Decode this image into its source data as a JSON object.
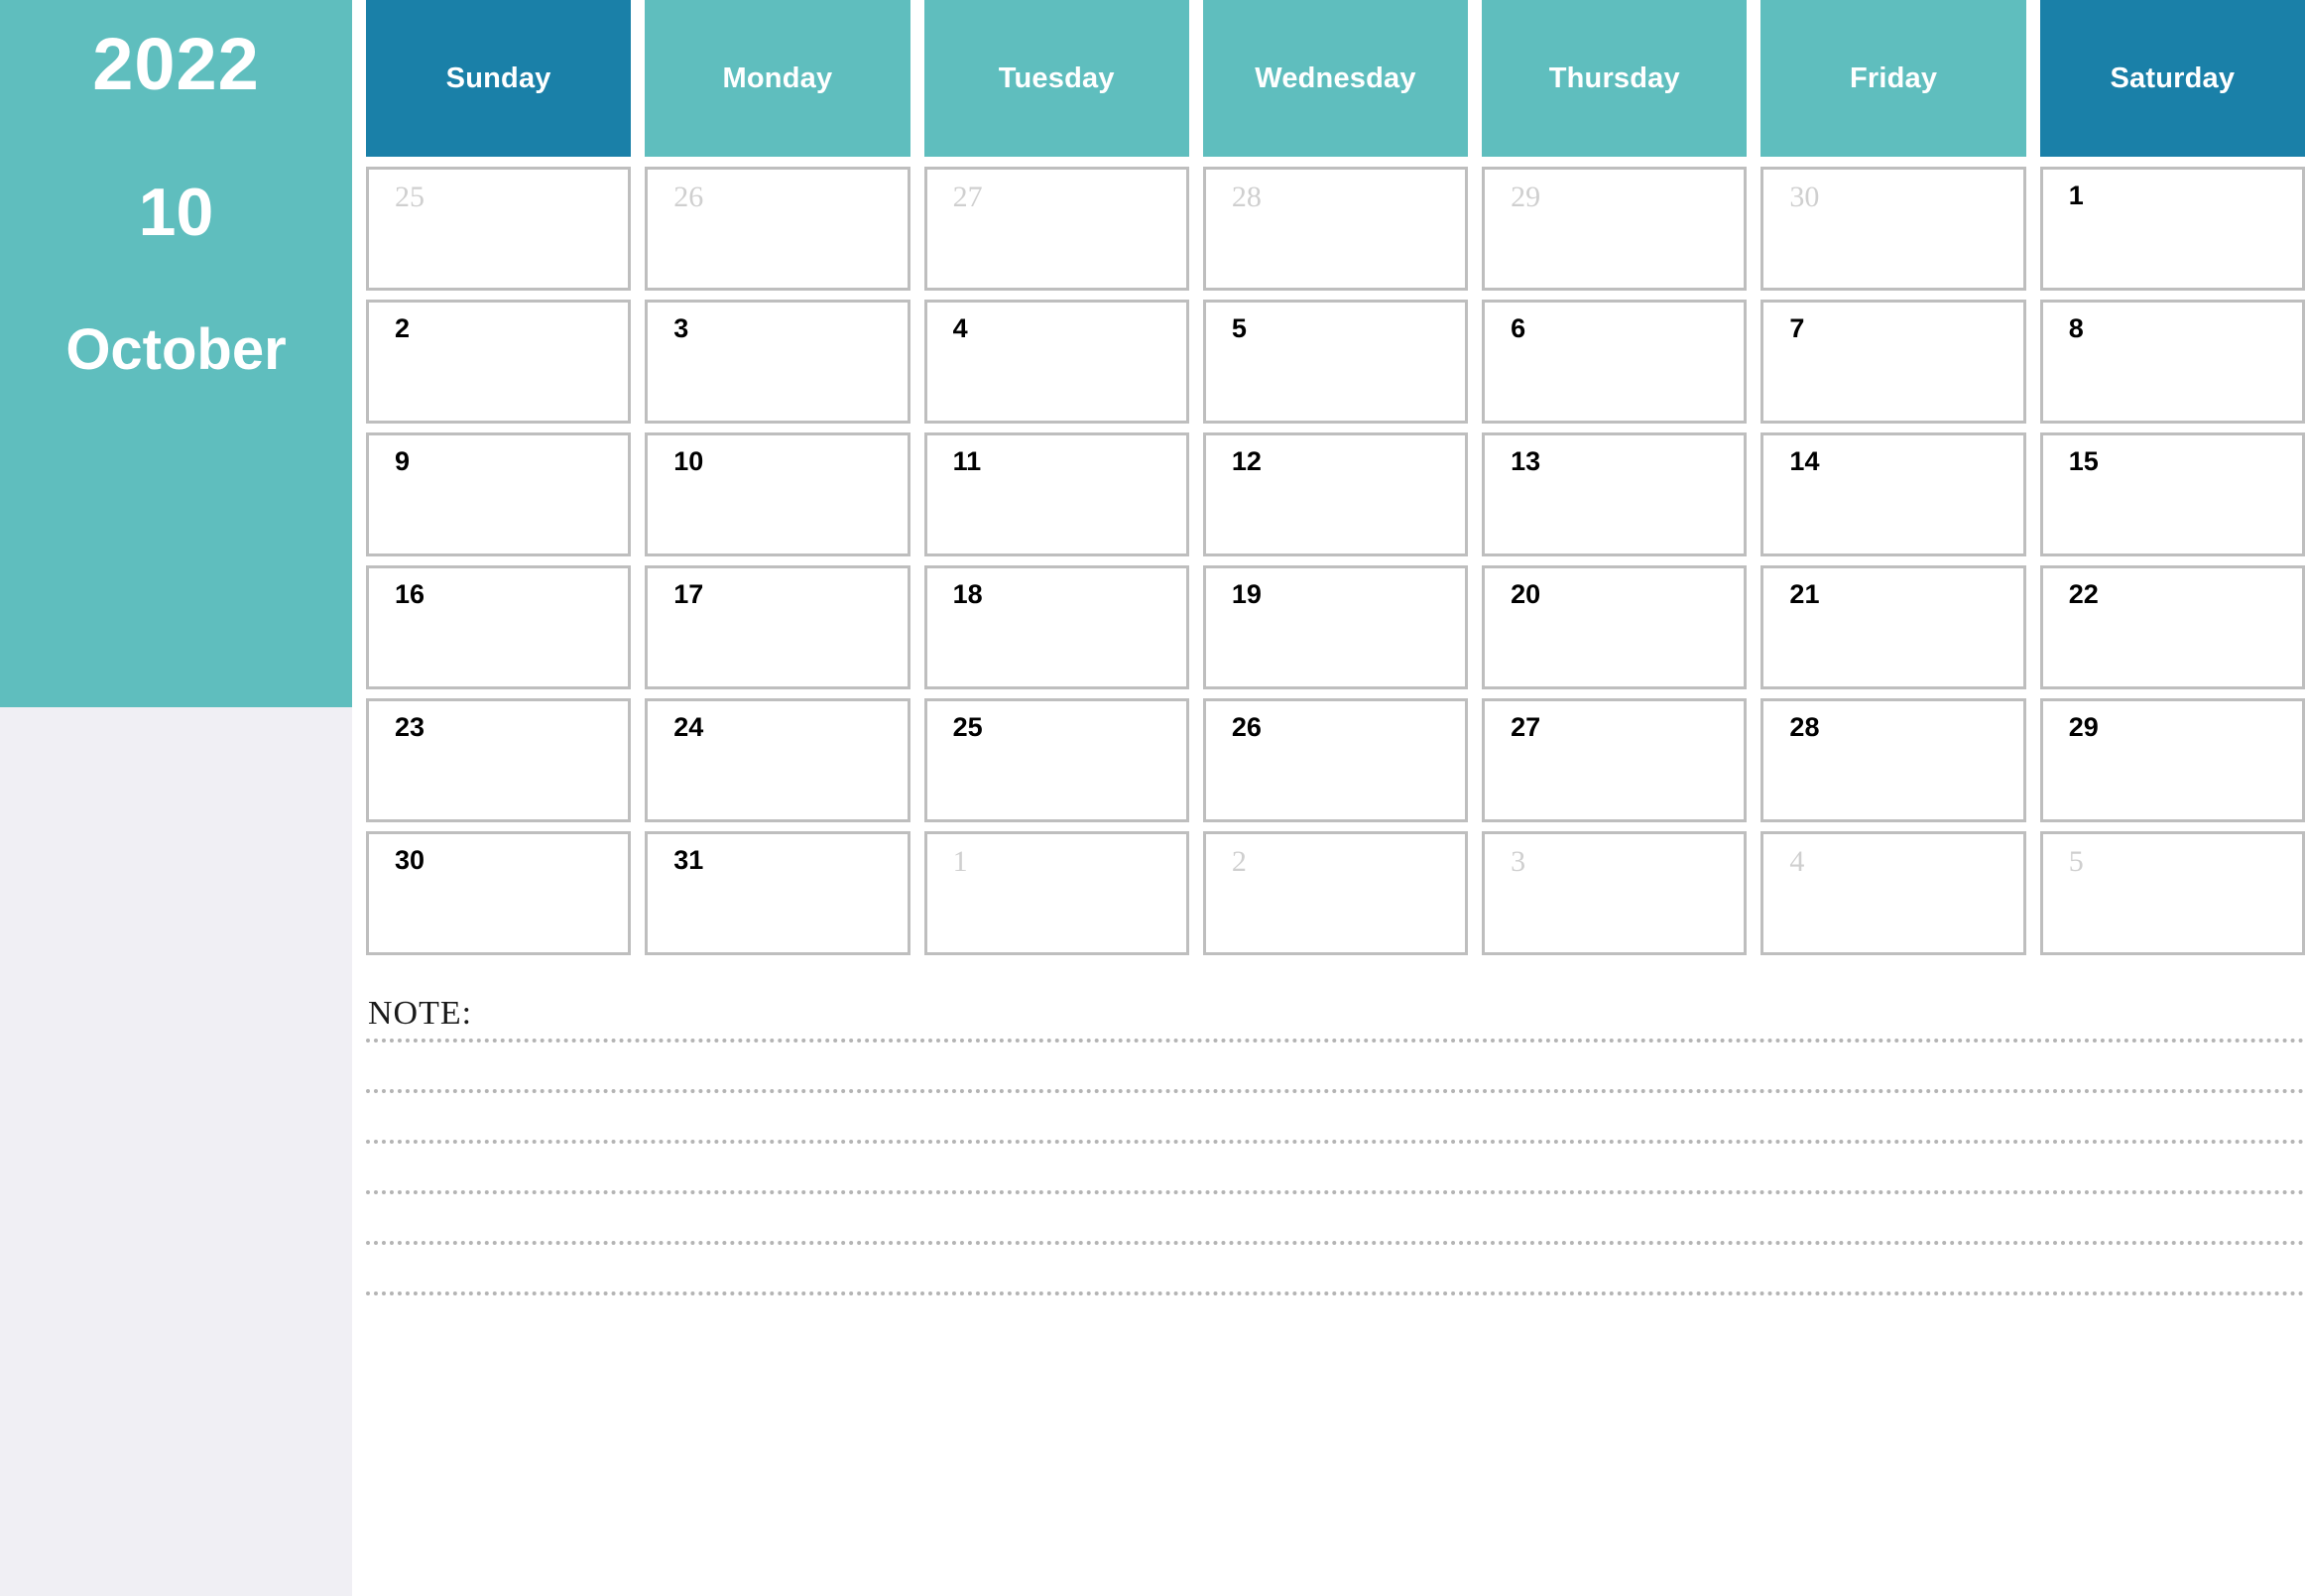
{
  "sidebar": {
    "year": "2022",
    "month_number": "10",
    "month_name": "October",
    "band_color": "#5FBEBE",
    "background_color": "#F0EFF4"
  },
  "colors": {
    "teal": "#5FBEBE",
    "weekend_blue": "#1A80A8",
    "cell_border": "#BEBEBE",
    "outside_day": "#CFCFCF",
    "note_line": "#B4B4B4",
    "sidebar_gray": "#F0EFF4"
  },
  "weekdays": [
    {
      "label": "Sunday",
      "weekend": true
    },
    {
      "label": "Monday",
      "weekend": false
    },
    {
      "label": "Tuesday",
      "weekend": false
    },
    {
      "label": "Wednesday",
      "weekend": false
    },
    {
      "label": "Thursday",
      "weekend": false
    },
    {
      "label": "Friday",
      "weekend": false
    },
    {
      "label": "Saturday",
      "weekend": true
    }
  ],
  "weeks": [
    [
      {
        "day": "25",
        "outside": true
      },
      {
        "day": "26",
        "outside": true
      },
      {
        "day": "27",
        "outside": true
      },
      {
        "day": "28",
        "outside": true
      },
      {
        "day": "29",
        "outside": true
      },
      {
        "day": "30",
        "outside": true
      },
      {
        "day": "1",
        "outside": false
      }
    ],
    [
      {
        "day": "2",
        "outside": false
      },
      {
        "day": "3",
        "outside": false
      },
      {
        "day": "4",
        "outside": false
      },
      {
        "day": "5",
        "outside": false
      },
      {
        "day": "6",
        "outside": false
      },
      {
        "day": "7",
        "outside": false
      },
      {
        "day": "8",
        "outside": false
      }
    ],
    [
      {
        "day": "9",
        "outside": false
      },
      {
        "day": "10",
        "outside": false
      },
      {
        "day": "11",
        "outside": false
      },
      {
        "day": "12",
        "outside": false
      },
      {
        "day": "13",
        "outside": false
      },
      {
        "day": "14",
        "outside": false
      },
      {
        "day": "15",
        "outside": false
      }
    ],
    [
      {
        "day": "16",
        "outside": false
      },
      {
        "day": "17",
        "outside": false
      },
      {
        "day": "18",
        "outside": false
      },
      {
        "day": "19",
        "outside": false
      },
      {
        "day": "20",
        "outside": false
      },
      {
        "day": "21",
        "outside": false
      },
      {
        "day": "22",
        "outside": false
      }
    ],
    [
      {
        "day": "23",
        "outside": false
      },
      {
        "day": "24",
        "outside": false
      },
      {
        "day": "25",
        "outside": false
      },
      {
        "day": "26",
        "outside": false
      },
      {
        "day": "27",
        "outside": false
      },
      {
        "day": "28",
        "outside": false
      },
      {
        "day": "29",
        "outside": false
      }
    ],
    [
      {
        "day": "30",
        "outside": false
      },
      {
        "day": "31",
        "outside": false
      },
      {
        "day": "1",
        "outside": true
      },
      {
        "day": "2",
        "outside": true
      },
      {
        "day": "3",
        "outside": true
      },
      {
        "day": "4",
        "outside": true
      },
      {
        "day": "5",
        "outside": true
      }
    ]
  ],
  "note": {
    "label": "NOTE:",
    "line_count": 6
  }
}
